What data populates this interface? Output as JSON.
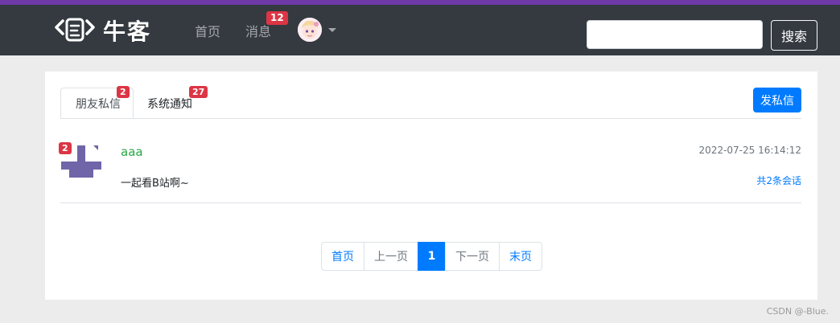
{
  "navbar": {
    "logo_text": "牛客",
    "home_label": "首页",
    "messages_label": "消息",
    "messages_badge": "12",
    "search": {
      "value": "",
      "placeholder": ""
    },
    "search_button": "搜索"
  },
  "tabs": {
    "friend": {
      "label": "朋友私信",
      "badge": "2"
    },
    "system": {
      "label": "系统通知",
      "badge": "27"
    }
  },
  "send_button": "发私信",
  "messages": [
    {
      "badge": "2",
      "username": "aaa",
      "time": "2022-07-25 16:14:12",
      "content": "一起看B站啊~",
      "count": "共2条会话"
    }
  ],
  "pagination": {
    "first": "首页",
    "prev": "上一页",
    "current": "1",
    "next": "下一页",
    "last": "末页"
  },
  "watermark": "CSDN @-Blue.",
  "colors": {
    "accent_strip": "#6f3aa8",
    "navbar": "#343a40",
    "primary": "#007bff",
    "badge": "#dc3545",
    "username": "#28a745",
    "identicon": "#7065a9"
  }
}
